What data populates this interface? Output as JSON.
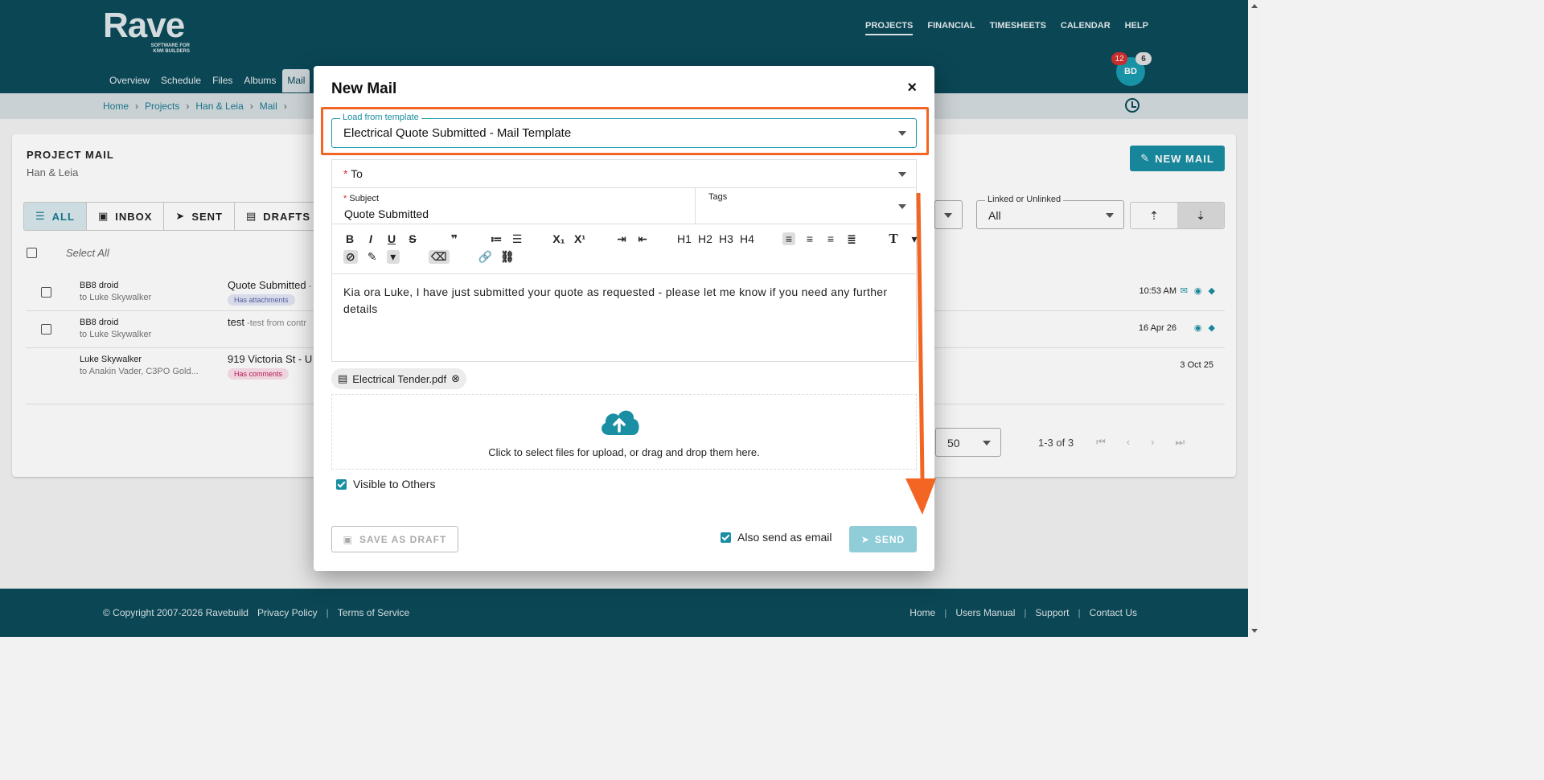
{
  "logo": {
    "main": "Rave",
    "sub1": "SOFTWARE FOR",
    "sub2": "KIWI BUILDERS"
  },
  "topnav": [
    "PROJECTS",
    "FINANCIAL",
    "TIMESHEETS",
    "CALENDAR",
    "HELP"
  ],
  "subnav": [
    "Overview",
    "Schedule",
    "Files",
    "Albums",
    "Mail"
  ],
  "user": {
    "initials": "BD",
    "badge_red": "12",
    "badge_grey": "6"
  },
  "breadcrumb": [
    "Home",
    "Projects",
    "Han & Leia",
    "Mail"
  ],
  "card": {
    "title": "PROJECT MAIL",
    "subtitle": "Han & Leia",
    "new_mail": "NEW MAIL"
  },
  "filters": [
    "ALL",
    "INBOX",
    "SENT",
    "DRAFTS"
  ],
  "select_all": "Select All",
  "rows": [
    {
      "from": "BB8 droid",
      "to": "to Luke Skywalker",
      "subject": "Quote Submitted",
      "snippet": " -",
      "tag": "Has attachments",
      "date": "10:53 AM"
    },
    {
      "from": "BB8 droid",
      "to": "to Luke Skywalker",
      "subject": "test",
      "snippet": " -test from contr",
      "tag": "",
      "date": "16 Apr 26"
    },
    {
      "from": "Luke Skywalker",
      "to": "to Anakin Vader, C3PO Gold...",
      "subject": "919 Victoria St - U",
      "snippet": "",
      "tag": "Has comments",
      "date": "3 Oct 25"
    }
  ],
  "linked": {
    "label": "Linked or Unlinked",
    "value": "All"
  },
  "pager": {
    "per_page": "50",
    "count": "1-3 of 3"
  },
  "modal": {
    "title": "New Mail",
    "close": "×",
    "template_label": "Load from template",
    "template_value": "Electrical Quote Submitted - Mail Template",
    "to_label": "To",
    "subject_label": "Subject",
    "subject_value": "Quote Submitted",
    "tags_label": "Tags",
    "body": "Kia ora Luke, I have just submitted your quote as requested - please let me know if you need any further details",
    "attachment": "Electrical Tender.pdf",
    "dropzone": "Click to select files for upload, or drag and drop them here.",
    "visible_label": "Visible to Others",
    "draft_label": "SAVE AS DRAFT",
    "also_label": "Also send as email",
    "send_label": "SEND"
  },
  "toolbar": {
    "h1": "H1",
    "h2": "H2",
    "h3": "H3",
    "h4": "H4"
  },
  "footer": {
    "copyright": "© Copyright 2007-2026 Ravebuild",
    "privacy": "Privacy Policy",
    "terms": "Terms of Service",
    "links": [
      "Home",
      "Users Manual",
      "Support",
      "Contact Us"
    ]
  },
  "colors": {
    "brand": "#0b4a59",
    "accent": "#1a8ea3",
    "highlight": "#f26522"
  }
}
